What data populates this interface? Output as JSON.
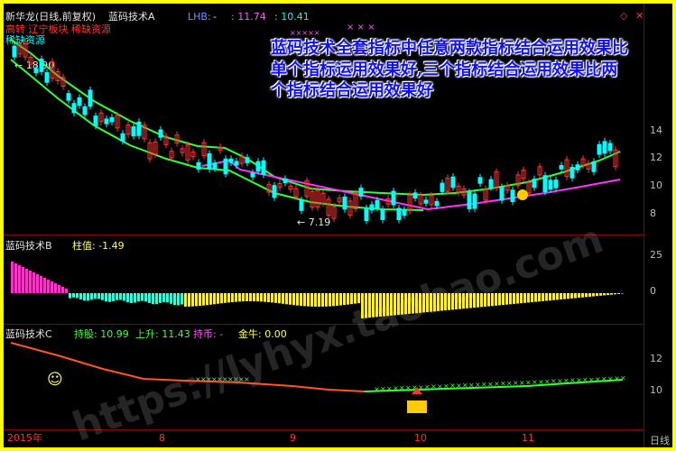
{
  "header": {
    "stock_name": "新华龙(日线,前复权)",
    "indicator_name": "蓝码技术A",
    "lhb_label": "LHB:",
    "lhb_value": "-",
    "value_1": ": 11.74",
    "value_2": ": 10.41",
    "marks": "×  ×  ×",
    "diamond": "◇",
    "close": "✕"
  },
  "main_panel": {
    "tags_line": "高转 辽宁板块 稀缺资源",
    "tag_scarce": "稀缺资源",
    "tiny_marks": "×××××",
    "high_label": "18.90",
    "low_label": "7.19",
    "annotation": "蓝码技术全套指标中任意两款指标结合运用效果比单个指标运用效果好,三个指标结合运用效果比两个指标结合运用效果好",
    "right_axis": [
      "14",
      "12",
      "10",
      "8"
    ]
  },
  "panel_b": {
    "title": "蓝码技术B",
    "value_label": "柱值: -1.49",
    "right_axis": [
      "25",
      "0"
    ]
  },
  "panel_c": {
    "title": "蓝码技术C",
    "hold_label": "持股: 10.99",
    "rise_label": "上升: 11.43",
    "coin_label": "持币: -",
    "golden_bull_label": "金牛: 0.00",
    "smiley": "☺",
    "right_axis": [
      "12",
      "10"
    ]
  },
  "xaxis": {
    "labels": [
      "2015年",
      "8",
      "9",
      "10",
      "11"
    ],
    "corner": "日线"
  },
  "watermark": "https://lyhyx.taobao.com",
  "colors": {
    "background": "#000000",
    "border": "#ffff00",
    "up_candle": "#ff3333",
    "down_candle": "#00ffff",
    "ma_green": "#33ff33",
    "ma_magenta": "#ff33ff",
    "bar_magenta": "#ff33cc",
    "bar_cyan": "#33ffdd",
    "bar_yellow": "#ffee33",
    "line_orange": "#ff5522",
    "annotation_text": "#1010ff"
  }
}
